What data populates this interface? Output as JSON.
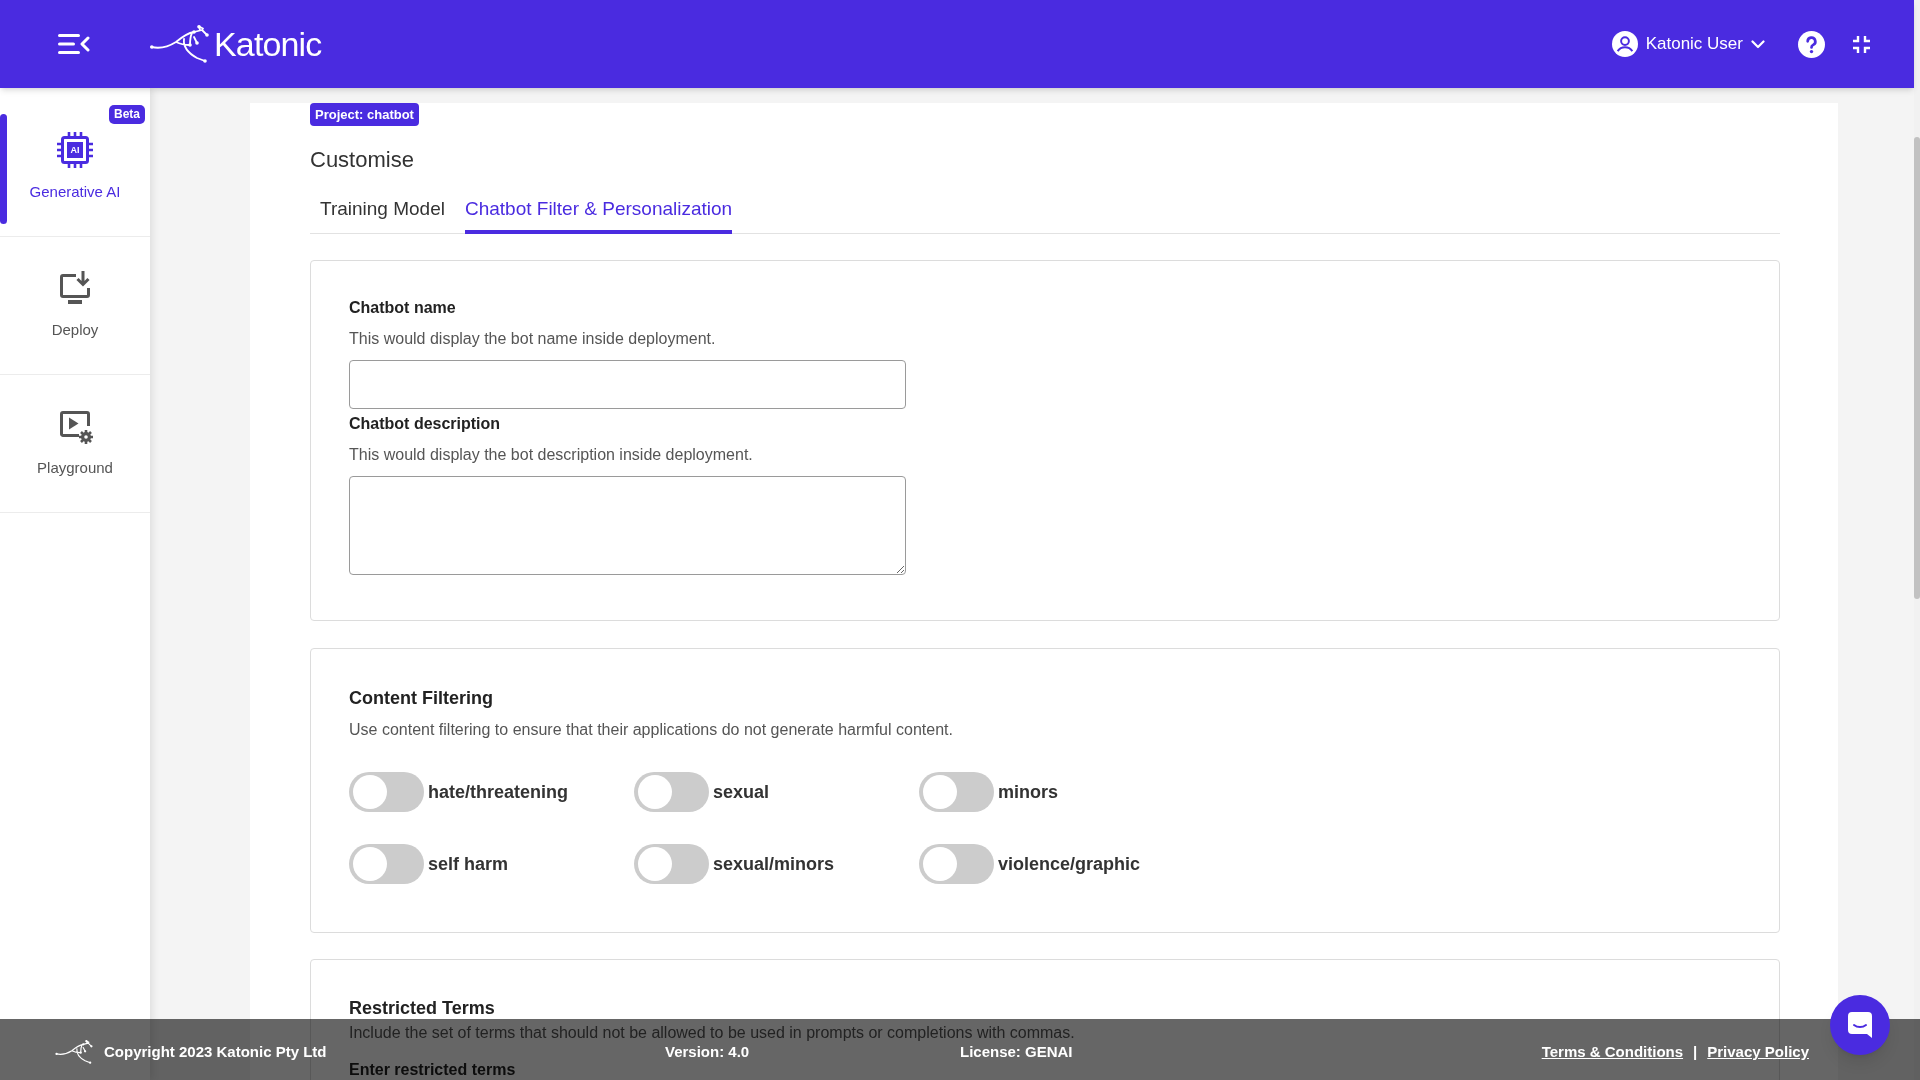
{
  "header": {
    "logo_text": "Katonic",
    "user_name": "Katonic User"
  },
  "sidebar": {
    "items": [
      {
        "label": "Generative AI",
        "icon_text": "AI",
        "badge": "Beta",
        "selected": true
      },
      {
        "label": "Deploy",
        "selected": false
      },
      {
        "label": "Playground",
        "selected": false
      }
    ]
  },
  "project_badge": "Project: chatbot",
  "page_title": "Customise",
  "tabs": [
    {
      "label": "Training Model",
      "selected": false
    },
    {
      "label": "Chatbot Filter & Personalization",
      "selected": true
    }
  ],
  "personalization": {
    "fields": [
      {
        "label": "Chatbot name",
        "description": "This would display the bot name inside deployment.",
        "kind": "input"
      },
      {
        "label": "Chatbot description",
        "description": "This would display the bot description inside deployment.",
        "kind": "textarea"
      }
    ]
  },
  "content_filtering": {
    "title": "Content Filtering",
    "description": "Use content filtering to ensure that their applications do not generate harmful content.",
    "toggles": [
      {
        "label": "hate/threatening",
        "on": false
      },
      {
        "label": "sexual",
        "on": false
      },
      {
        "label": "minors",
        "on": false
      },
      {
        "label": "self harm",
        "on": false
      },
      {
        "label": "sexual/minors",
        "on": false
      },
      {
        "label": "violence/graphic",
        "on": false
      }
    ]
  },
  "restricted_terms": {
    "title": "Restricted Terms",
    "description": "Include the set of terms that should not be allowed to be used in prompts or completions with commas.",
    "field_label": "Enter restricted terms"
  },
  "footer": {
    "copyright": "Copyright 2023 Katonic Pty Ltd",
    "version": "Version: 4.0",
    "license": "License: GENAI",
    "links": [
      "Terms & Conditions",
      "Privacy Policy"
    ],
    "separator": "|"
  }
}
